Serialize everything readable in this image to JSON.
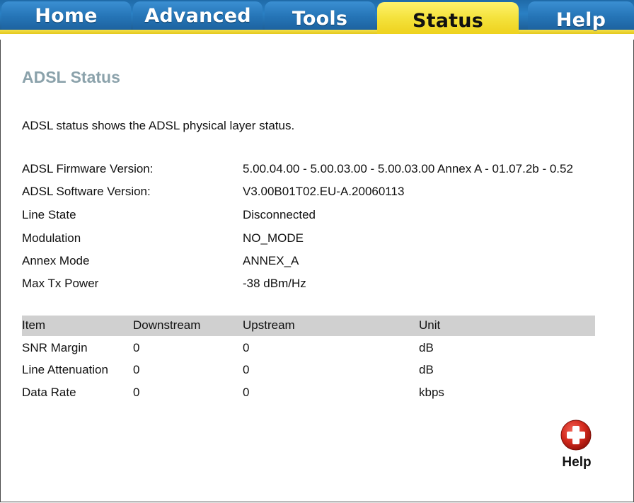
{
  "nav": {
    "tabs": [
      {
        "label": "Home"
      },
      {
        "label": "Advanced"
      },
      {
        "label": "Tools"
      },
      {
        "label": "Status",
        "active": true
      },
      {
        "label": "Help"
      }
    ]
  },
  "page": {
    "title": "ADSL Status",
    "description": "ADSL status shows the ADSL physical layer status."
  },
  "info": [
    {
      "label": "ADSL Firmware Version:",
      "value": "5.00.04.00 - 5.00.03.00 - 5.00.03.00 Annex A - 01.07.2b - 0.52"
    },
    {
      "label": "ADSL Software Version:",
      "value": "V3.00B01T02.EU-A.20060113"
    },
    {
      "label": "Line State",
      "value": "Disconnected"
    },
    {
      "label": "Modulation",
      "value": "NO_MODE"
    },
    {
      "label": "Annex Mode",
      "value": "ANNEX_A"
    },
    {
      "label": "Max Tx Power",
      "value": "-38 dBm/Hz"
    }
  ],
  "stats": {
    "headers": [
      "Item",
      "Downstream",
      "Upstream",
      "Unit"
    ],
    "rows": [
      [
        "SNR Margin",
        "0",
        "0",
        "dB"
      ],
      [
        "Line Attenuation",
        "0",
        "0",
        "dB"
      ],
      [
        "Data Rate",
        "0",
        "0",
        "kbps"
      ]
    ]
  },
  "help_button": {
    "label": "Help",
    "icon": "plus-circle-icon"
  },
  "colors": {
    "tab_blue": "#2574b6",
    "tab_active_yellow": "#f4e23c",
    "title_gray": "#8ba2ab",
    "header_row_gray": "#d0d0d0",
    "help_icon_red": "#d42a1e"
  }
}
